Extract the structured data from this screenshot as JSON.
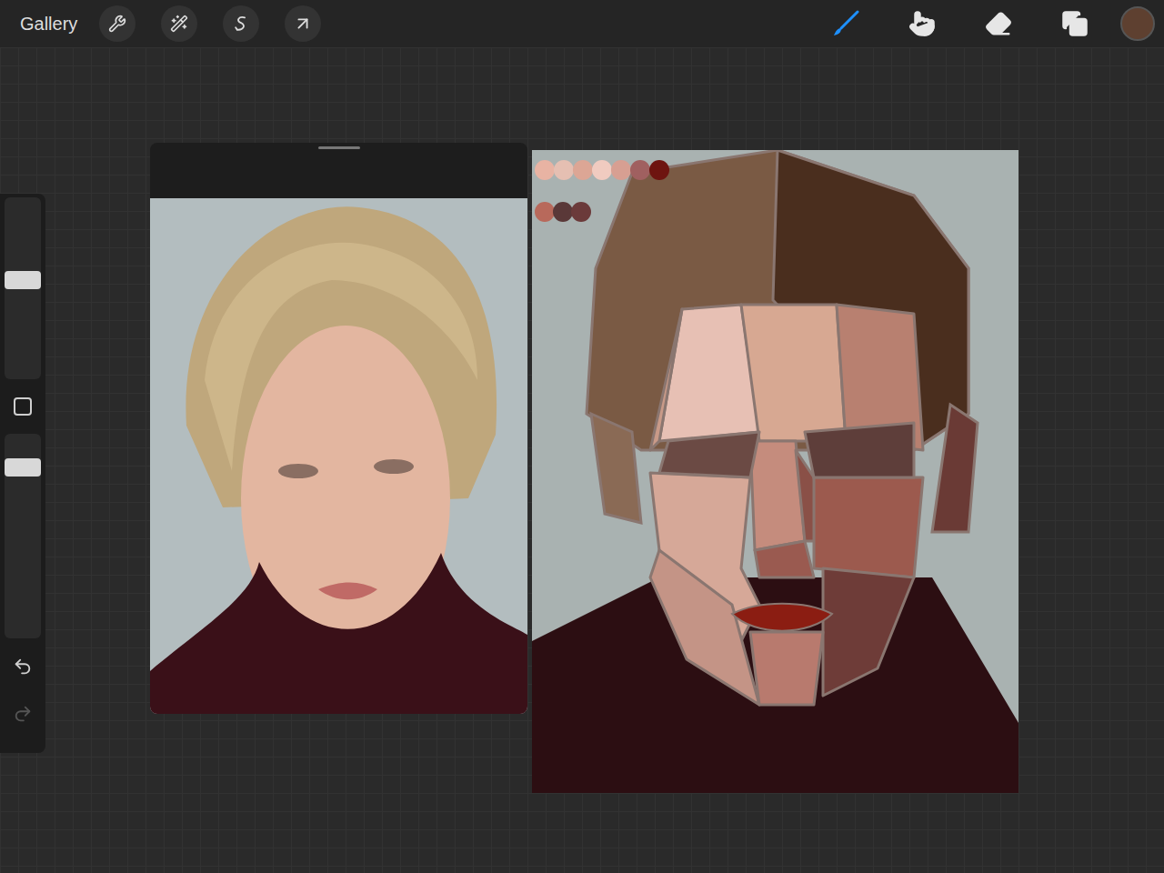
{
  "toolbar": {
    "gallery": "Gallery",
    "actions": [
      {
        "kind": "wrench"
      },
      {
        "kind": "adjust"
      },
      {
        "kind": "select"
      },
      {
        "kind": "transform"
      }
    ],
    "tools": [
      {
        "kind": "brush",
        "selected": true
      },
      {
        "kind": "smudge",
        "selected": false
      },
      {
        "kind": "eraser",
        "selected": false
      },
      {
        "kind": "layers",
        "selected": false
      }
    ],
    "current_color": "#5e4030"
  },
  "sidebar": {
    "size_level": 0.55,
    "opacity_level": 0.87
  }
}
